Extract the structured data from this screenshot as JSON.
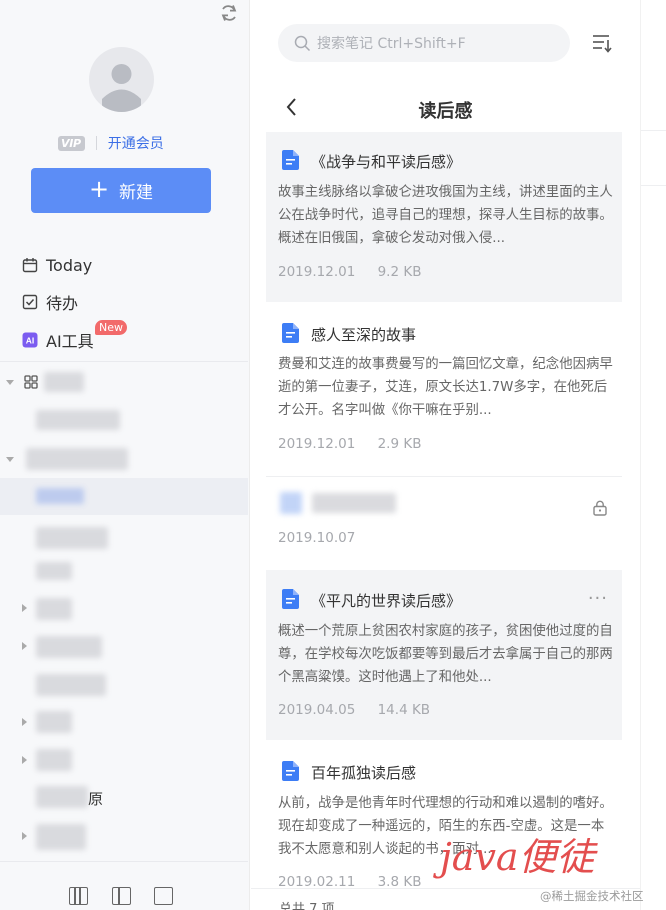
{
  "sidebar": {
    "vip_badge": "VIP",
    "vip_link": "开通会员",
    "new_button": "新建",
    "nav": {
      "today": "Today",
      "todo": "待办",
      "ai_tools": "AI工具",
      "ai_badge": "New"
    },
    "tree_fragment_1": "原",
    "accent_color": "#5c8df6"
  },
  "middle": {
    "search_placeholder": "搜索笔记 Ctrl+Shift+F",
    "folder_title": "读后感",
    "notes": [
      {
        "title": "《战争与和平读后感》",
        "body": "故事主线脉络以拿破仑进攻俄国为主线，讲述里面的主人公在战争时代，追寻自己的理想，探寻人生目标的故事。概述在旧俄国，拿破仑发动对俄入侵...",
        "date": "2019.12.01",
        "size": "9.2 KB"
      },
      {
        "title": "感人至深的故事",
        "body": "费曼和艾连的故事费曼写的一篇回忆文章，纪念他因病早逝的第一位妻子，艾连，原文长达1.7W多字，在他死后才公开。名字叫做《你干嘛在乎别...",
        "date": "2019.12.01",
        "size": "2.9 KB"
      },
      {
        "title": "",
        "date": "2019.10.07",
        "locked": true
      },
      {
        "title": "《平凡的世界读后感》",
        "body": "概述一个荒原上贫困农村家庭的孩子，贫困使他过度的自尊，在学校每次吃饭都要等到最后才去拿属于自己的那两个黑高粱馍。这时他遇上了和他处...",
        "date": "2019.04.05",
        "size": "14.4 KB"
      },
      {
        "title": "百年孤独读后感",
        "body": "从前，战争是他青年时代理想的行动和难以遏制的嗜好。现在却变成了一种遥远的，陌生的东西-空虚。这是一本我不太愿意和别人谈起的书，面对...",
        "date": "2019.02.11",
        "size": "3.8 KB"
      }
    ],
    "more_icon": "···",
    "footer": "总共 7 项"
  },
  "watermark": {
    "big": "java便徒",
    "small": "@稀土掘金技术社区"
  }
}
